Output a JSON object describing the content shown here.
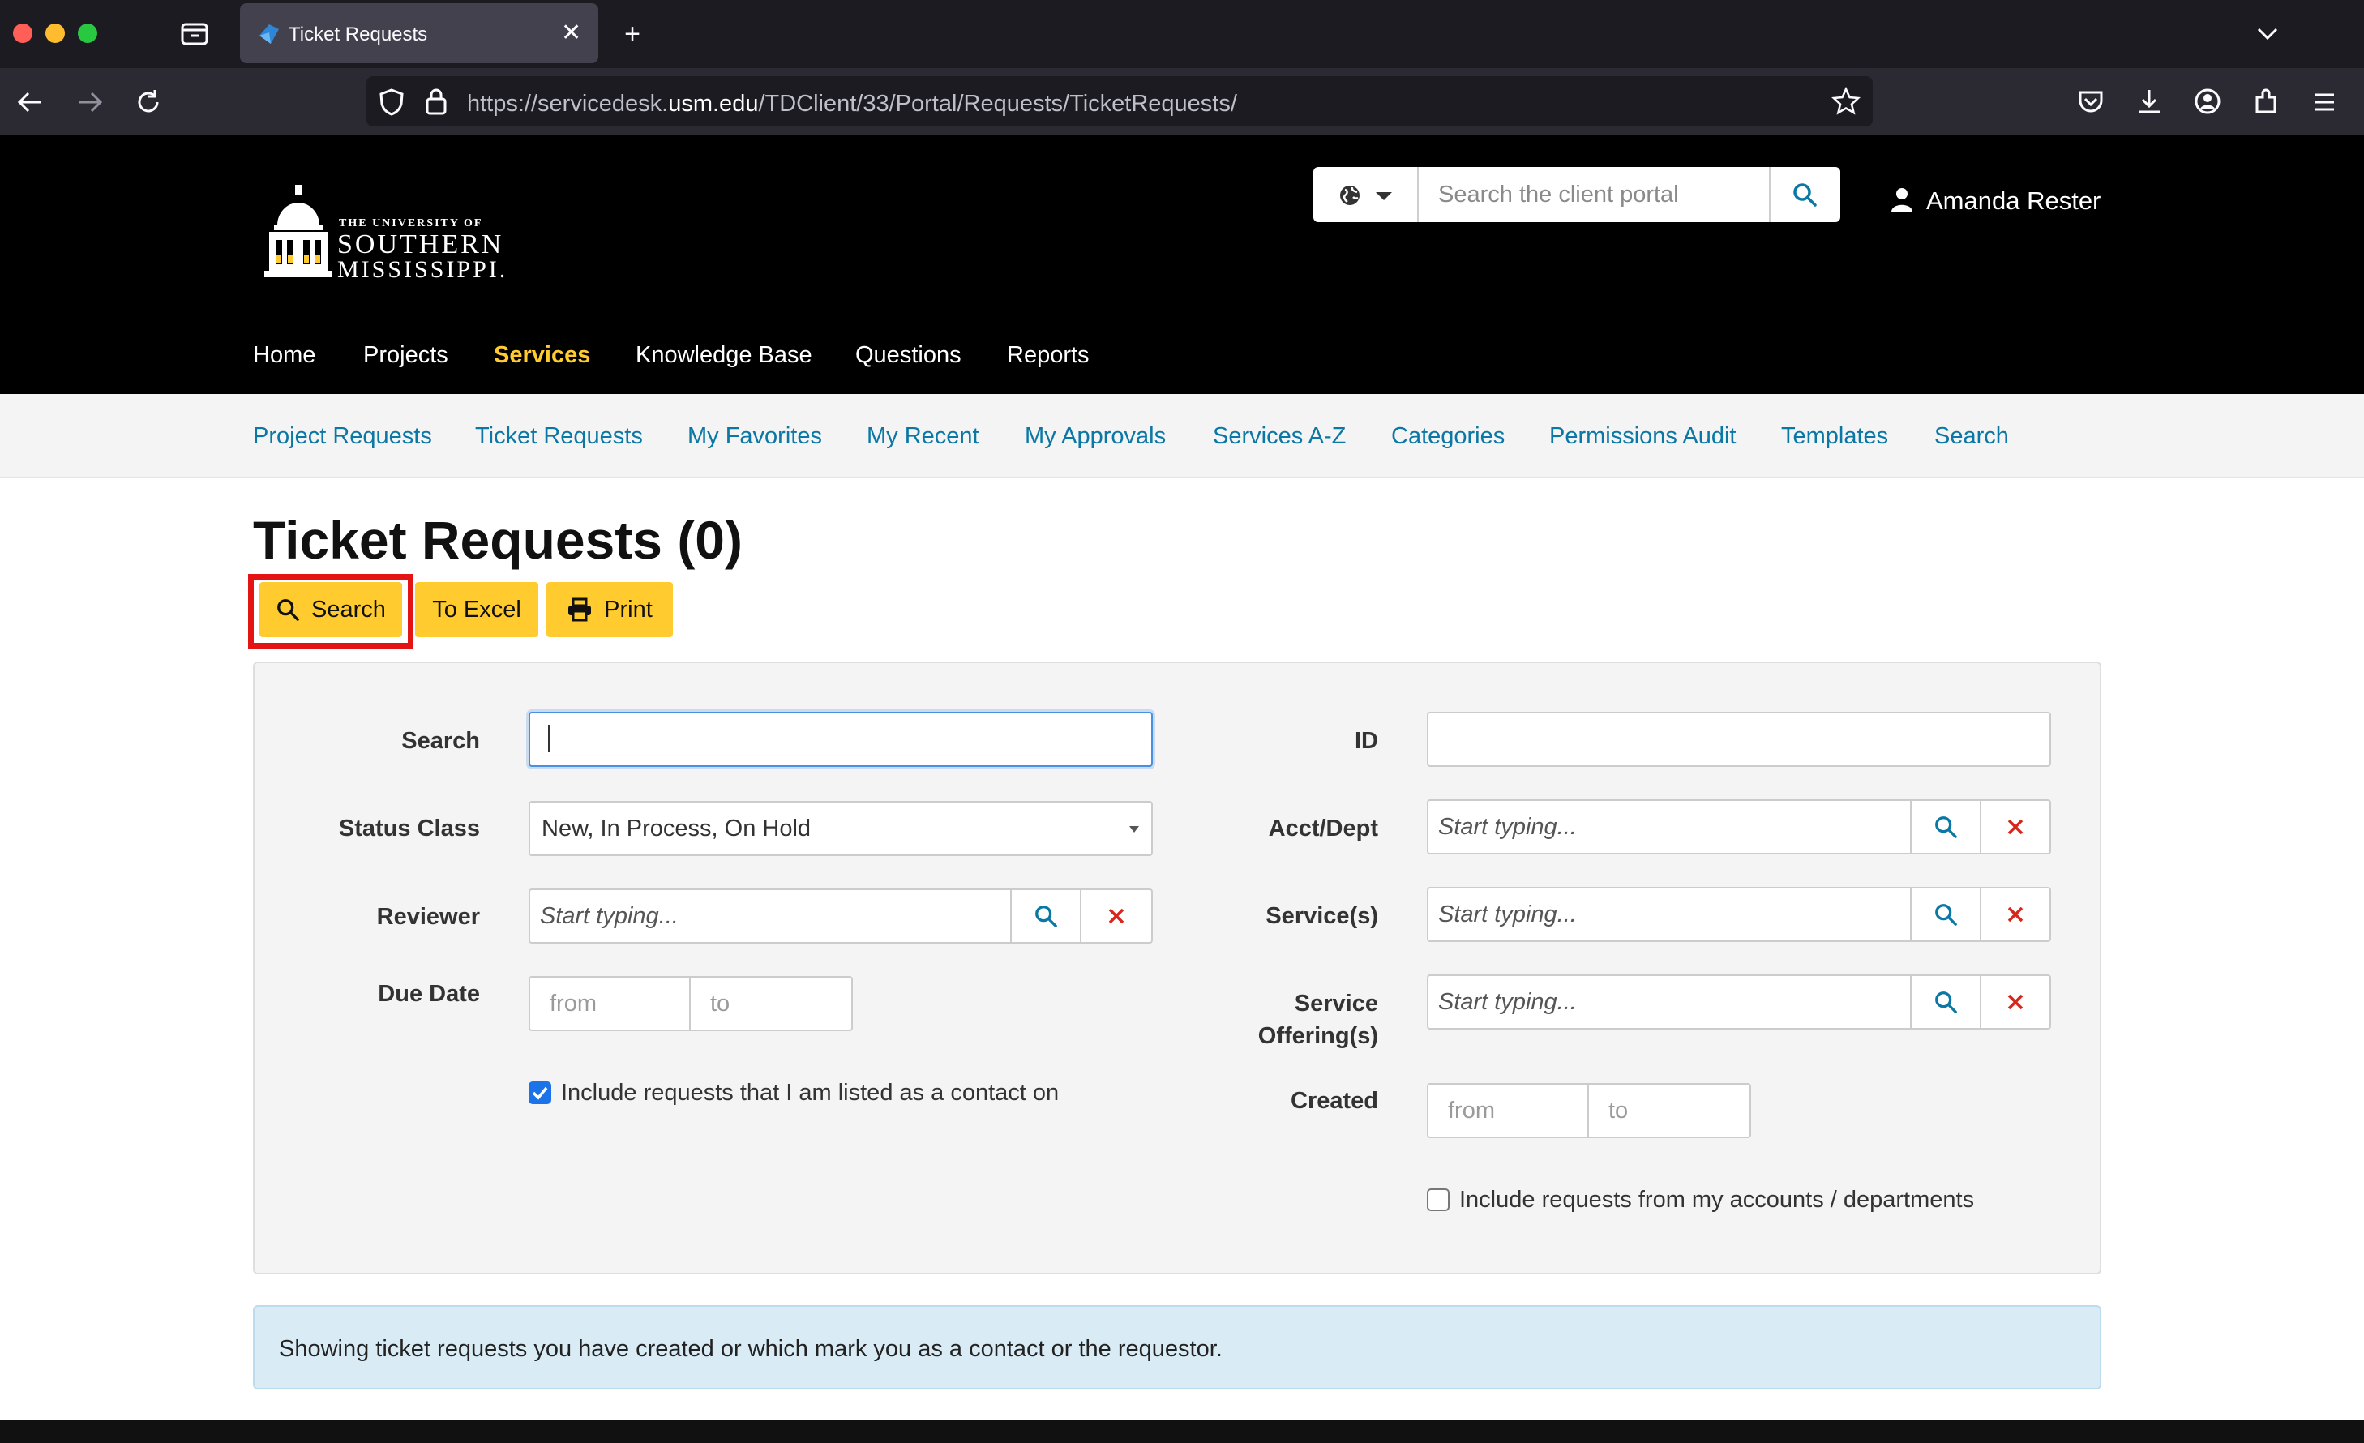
{
  "browser": {
    "tab_title": "Ticket Requests",
    "url_prefix": "https://servicedesk.",
    "url_domain": "usm.edu",
    "url_path": "/TDClient/33/Portal/Requests/TicketRequests/"
  },
  "header": {
    "logo": {
      "line1": "THE UNIVERSITY OF",
      "line2": "SOUTHERN",
      "line3": "MISSISSIPPI."
    },
    "search_placeholder": "Search the client portal",
    "user_name": "Amanda Rester",
    "accent_color": "#ffcb2f"
  },
  "main_nav": [
    {
      "label": "Home"
    },
    {
      "label": "Projects"
    },
    {
      "label": "Services",
      "active": true
    },
    {
      "label": "Knowledge Base"
    },
    {
      "label": "Questions"
    },
    {
      "label": "Reports"
    }
  ],
  "sub_nav": [
    {
      "label": "Project Requests"
    },
    {
      "label": "Ticket Requests"
    },
    {
      "label": "My Favorites"
    },
    {
      "label": "My Recent"
    },
    {
      "label": "My Approvals"
    },
    {
      "label": "Services A-Z"
    },
    {
      "label": "Categories"
    },
    {
      "label": "Permissions Audit"
    },
    {
      "label": "Templates"
    },
    {
      "label": "Search"
    }
  ],
  "page": {
    "title": "Ticket Requests (0)",
    "buttons": {
      "search": "Search",
      "excel": "To Excel",
      "print": "Print"
    }
  },
  "filters": {
    "search_label": "Search",
    "search_value": "",
    "status_class_label": "Status Class",
    "status_class_value": "New, In Process, On Hold",
    "reviewer_label": "Reviewer",
    "reviewer_placeholder": "Start typing...",
    "due_date_label": "Due Date",
    "from_placeholder": "from",
    "to_placeholder": "to",
    "include_contact_label": "Include requests that I am listed as a contact on",
    "include_contact_checked": true,
    "id_label": "ID",
    "acct_label": "Acct/Dept",
    "acct_placeholder": "Start typing...",
    "services_label": "Service(s)",
    "services_placeholder": "Start typing...",
    "offering_label_1": "Service",
    "offering_label_2": "Offering(s)",
    "offering_placeholder": "Start typing...",
    "created_label": "Created",
    "include_accounts_label": "Include requests from my accounts / departments",
    "include_accounts_checked": false
  },
  "info": {
    "message": "Showing ticket requests you have created or which mark you as a contact or the requestor."
  }
}
